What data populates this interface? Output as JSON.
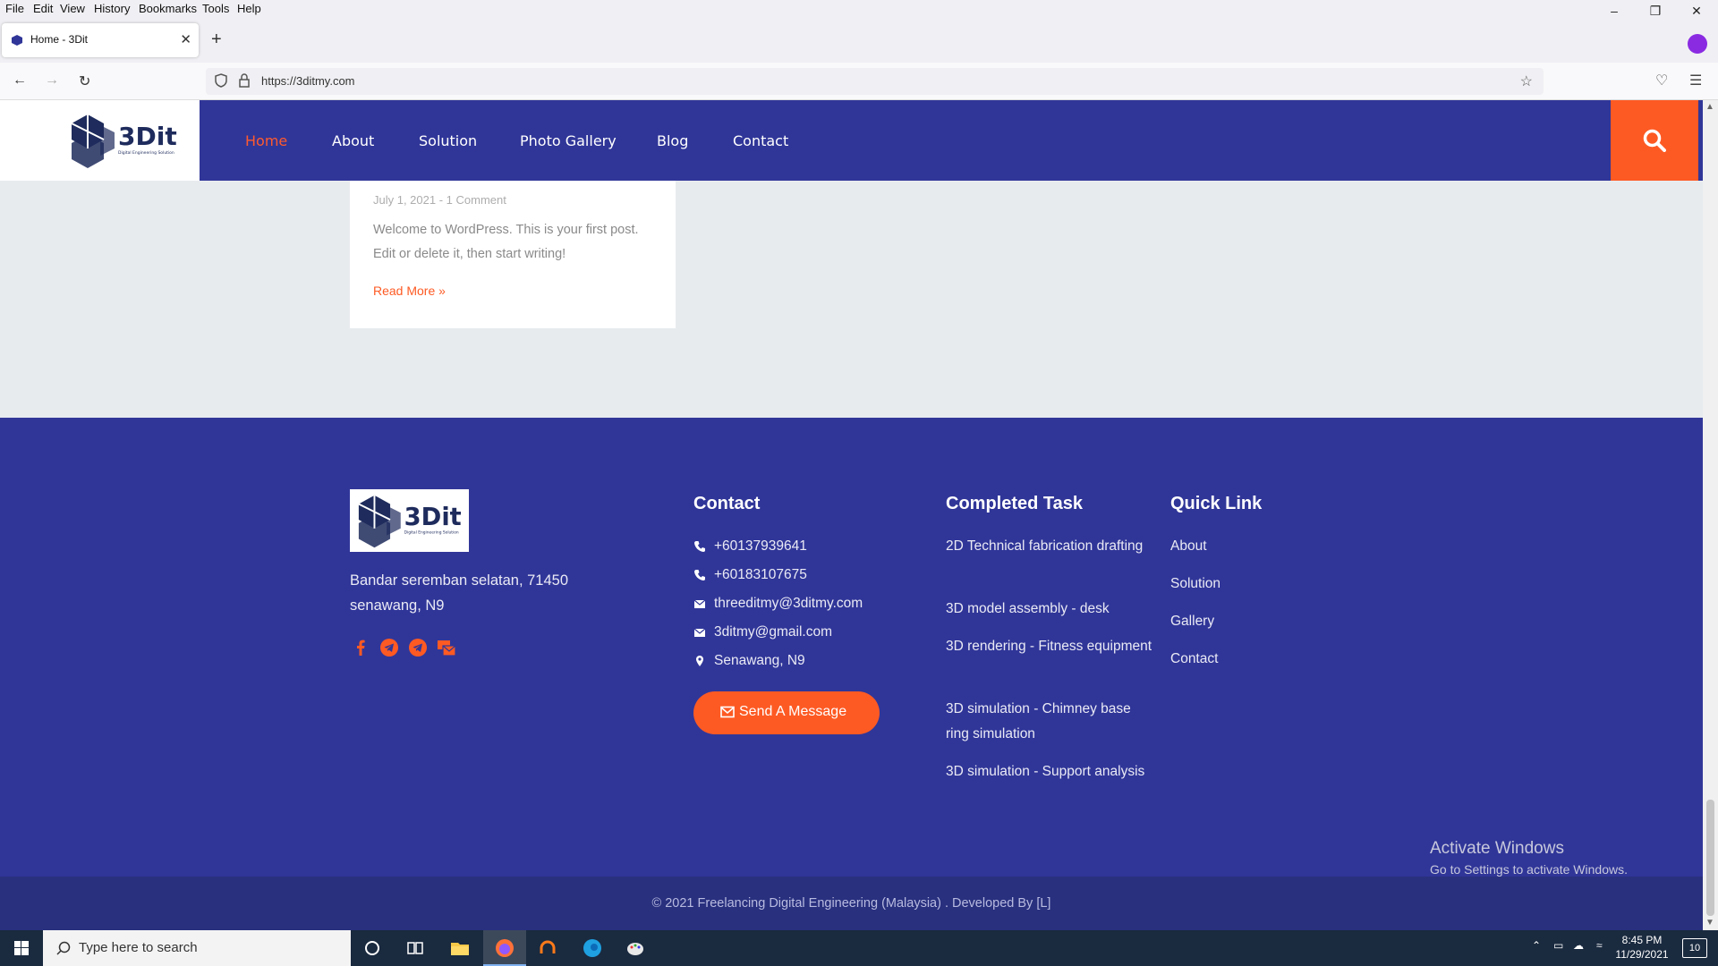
{
  "browser": {
    "menu": [
      "File",
      "Edit",
      "View",
      "History",
      "Bookmarks",
      "Tools",
      "Help"
    ],
    "tab_title": "Home - 3Dit",
    "url": "https://3ditmy.com"
  },
  "site": {
    "logo_text": "3Dit",
    "logo_tagline": "Digital Engineering Solution",
    "nav": [
      "Home",
      "About",
      "Solution",
      "Photo Gallery",
      "Blog",
      "Contact"
    ],
    "active_nav": "Home"
  },
  "post": {
    "meta": "July 1, 2021 - 1 Comment",
    "excerpt": "Welcome to WordPress. This is your first post. Edit or delete it, then start writing!",
    "read_more": "Read More »"
  },
  "footer": {
    "address": "Bandar seremban selatan, 71450 senawang, N9",
    "socials": [
      "facebook-icon",
      "telegram-icon",
      "telegram-icon",
      "mail-bulk-icon"
    ],
    "contact_title": "Contact",
    "contacts": [
      {
        "icon": "phone-icon",
        "text": "+60137939641"
      },
      {
        "icon": "phone-icon",
        "text": "+60183107675"
      },
      {
        "icon": "envelope-icon",
        "text": "threeditmy@3ditmy.com"
      },
      {
        "icon": "envelope-icon",
        "text": "3ditmy@gmail.com"
      },
      {
        "icon": "map-marker-icon",
        "text": "Senawang, N9"
      }
    ],
    "send_button": "Send A Message",
    "tasks_title": "Completed Task",
    "tasks": [
      "2D Technical fabrication drafting",
      "3D model assembly - desk",
      "3D rendering - Fitness equipment",
      "3D simulation - Chimney base ring simulation",
      "3D simulation - Support analysis"
    ],
    "quicklink_title": "Quick Link",
    "quicklinks": [
      "About",
      "Solution",
      "Gallery",
      "Contact"
    ],
    "copyright": "© 2021 Freelancing Digital Engineering (Malaysia) . Developed By [L]"
  },
  "watermark": {
    "line1": "Activate Windows",
    "line2": "Go to Settings to activate Windows."
  },
  "taskbar": {
    "search_placeholder": "Type here to search",
    "time": "8:45 PM",
    "date": "11/29/2021",
    "notification_count": "10"
  },
  "colors": {
    "brand_blue": "#303698",
    "accent_orange": "#fd5a23"
  }
}
